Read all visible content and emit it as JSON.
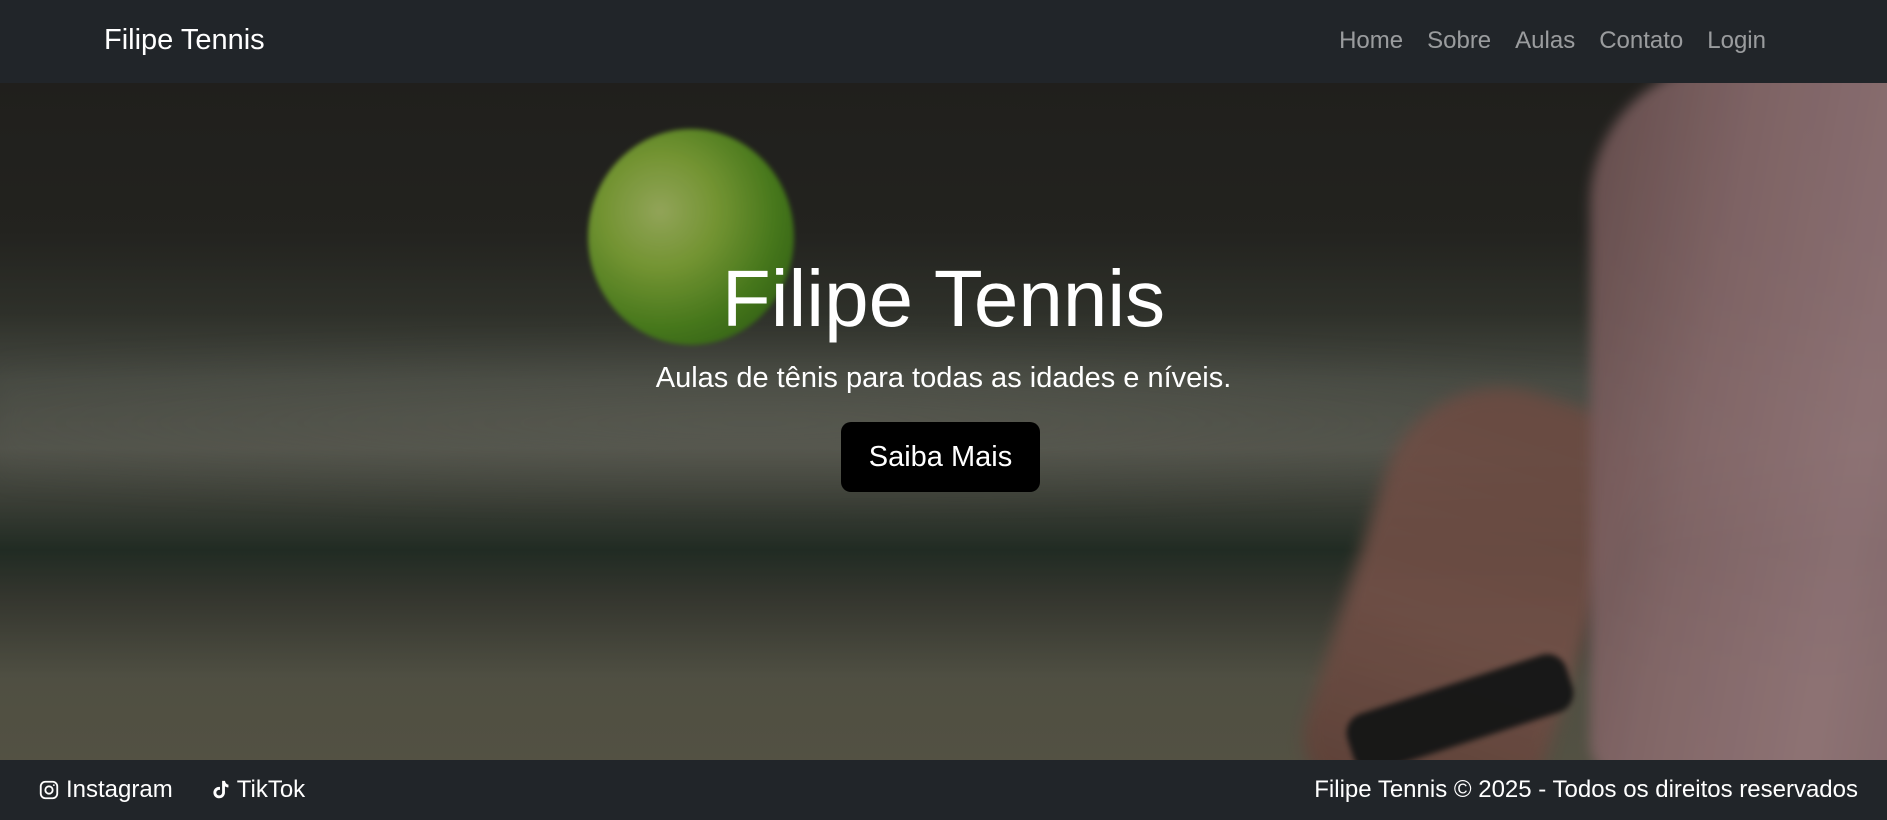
{
  "navbar": {
    "brand": "Filipe Tennis",
    "links": [
      {
        "label": "Home"
      },
      {
        "label": "Sobre"
      },
      {
        "label": "Aulas"
      },
      {
        "label": "Contato"
      },
      {
        "label": "Login"
      }
    ]
  },
  "hero": {
    "title": "Filipe Tennis",
    "subtitle": "Aulas de tênis para todas as idades e níveis.",
    "cta_label": "Saiba Mais"
  },
  "footer": {
    "social": [
      {
        "label": "Instagram",
        "icon": "instagram-icon"
      },
      {
        "label": "TikTok",
        "icon": "tiktok-icon"
      }
    ],
    "copyright": "Filipe Tennis © 2025 - Todos os direitos reservados"
  },
  "colors": {
    "navbar_bg": "#212529",
    "nav_link": "#8c8f92",
    "button_bg": "#000000",
    "text": "#ffffff"
  }
}
